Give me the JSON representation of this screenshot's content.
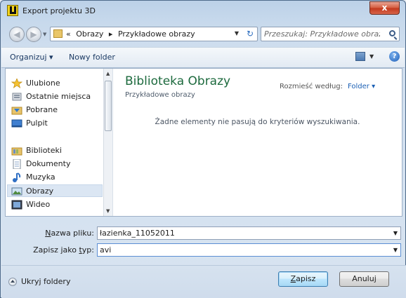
{
  "window": {
    "title": "Export projektu 3D",
    "close_label": "x"
  },
  "nav": {
    "path": [
      "«",
      "Obrazy",
      "▸",
      "Przykładowe obrazy"
    ],
    "search_placeholder": "Przeszukaj: Przykładowe obrazy"
  },
  "toolbar": {
    "organize_label": "Organizuj ▾",
    "new_folder_label": "Nowy folder",
    "help_label": "?"
  },
  "sidebar": {
    "items": [
      {
        "label": "Ulubione",
        "icon": "star-icon"
      },
      {
        "label": "Ostatnie miejsca",
        "icon": "recent-places-icon"
      },
      {
        "label": "Pobrane",
        "icon": "downloads-icon"
      },
      {
        "label": "Pulpit",
        "icon": "desktop-icon"
      },
      {
        "label": "Biblioteki",
        "icon": "libraries-icon"
      },
      {
        "label": "Dokumenty",
        "icon": "documents-icon"
      },
      {
        "label": "Muzyka",
        "icon": "music-icon"
      },
      {
        "label": "Obrazy",
        "icon": "pictures-icon",
        "selected": true
      },
      {
        "label": "Wideo",
        "icon": "video-icon"
      }
    ]
  },
  "main": {
    "library_title": "Biblioteka Obrazy",
    "library_subtitle": "Przykładowe obrazy",
    "arrange_label": "Rozmieść według:",
    "arrange_value": "Folder ▾",
    "empty_message": "Żadne elementy nie pasują do kryteriów wyszukiwania."
  },
  "form": {
    "filename_label": "Nazwa pliku:",
    "filename_value": "łazienka_11052011",
    "filetype_label": "Zapisz jako typ:",
    "filetype_value": "avi"
  },
  "footer": {
    "hide_folders_label": "Ukryj foldery",
    "save_label": "Zapisz",
    "cancel_label": "Anuluj"
  },
  "colors": {
    "library_title": "#1d6a3e",
    "link_blue": "#1a5fb4",
    "selection": "#dbe6f3"
  }
}
